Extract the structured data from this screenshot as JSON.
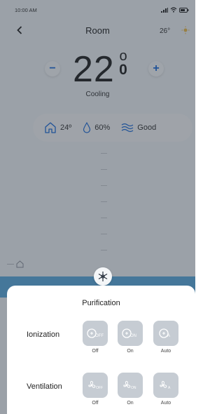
{
  "status_bar": {
    "time": "10:00 AM"
  },
  "header": {
    "title": "Room",
    "outside_temp": "26°"
  },
  "setpoint": {
    "value": "22",
    "unit_degree": "o",
    "unit_scale": "0",
    "minus_label": "−",
    "plus_label": "+"
  },
  "mode": {
    "label": "Cooling"
  },
  "info": {
    "indoor_temp": "24º",
    "humidity": "60%",
    "air_quality": "Good"
  },
  "sheet": {
    "title": "Purification",
    "rows": [
      {
        "label": "Ionization",
        "options": [
          "Off",
          "On",
          "Auto"
        ]
      },
      {
        "label": "Ventilation",
        "options": [
          "Off",
          "On",
          "Auto"
        ]
      }
    ]
  },
  "colors": {
    "accent": "#1d6bd9",
    "option_bg": "#c6ccd3",
    "strip": "#5aa9dc"
  }
}
